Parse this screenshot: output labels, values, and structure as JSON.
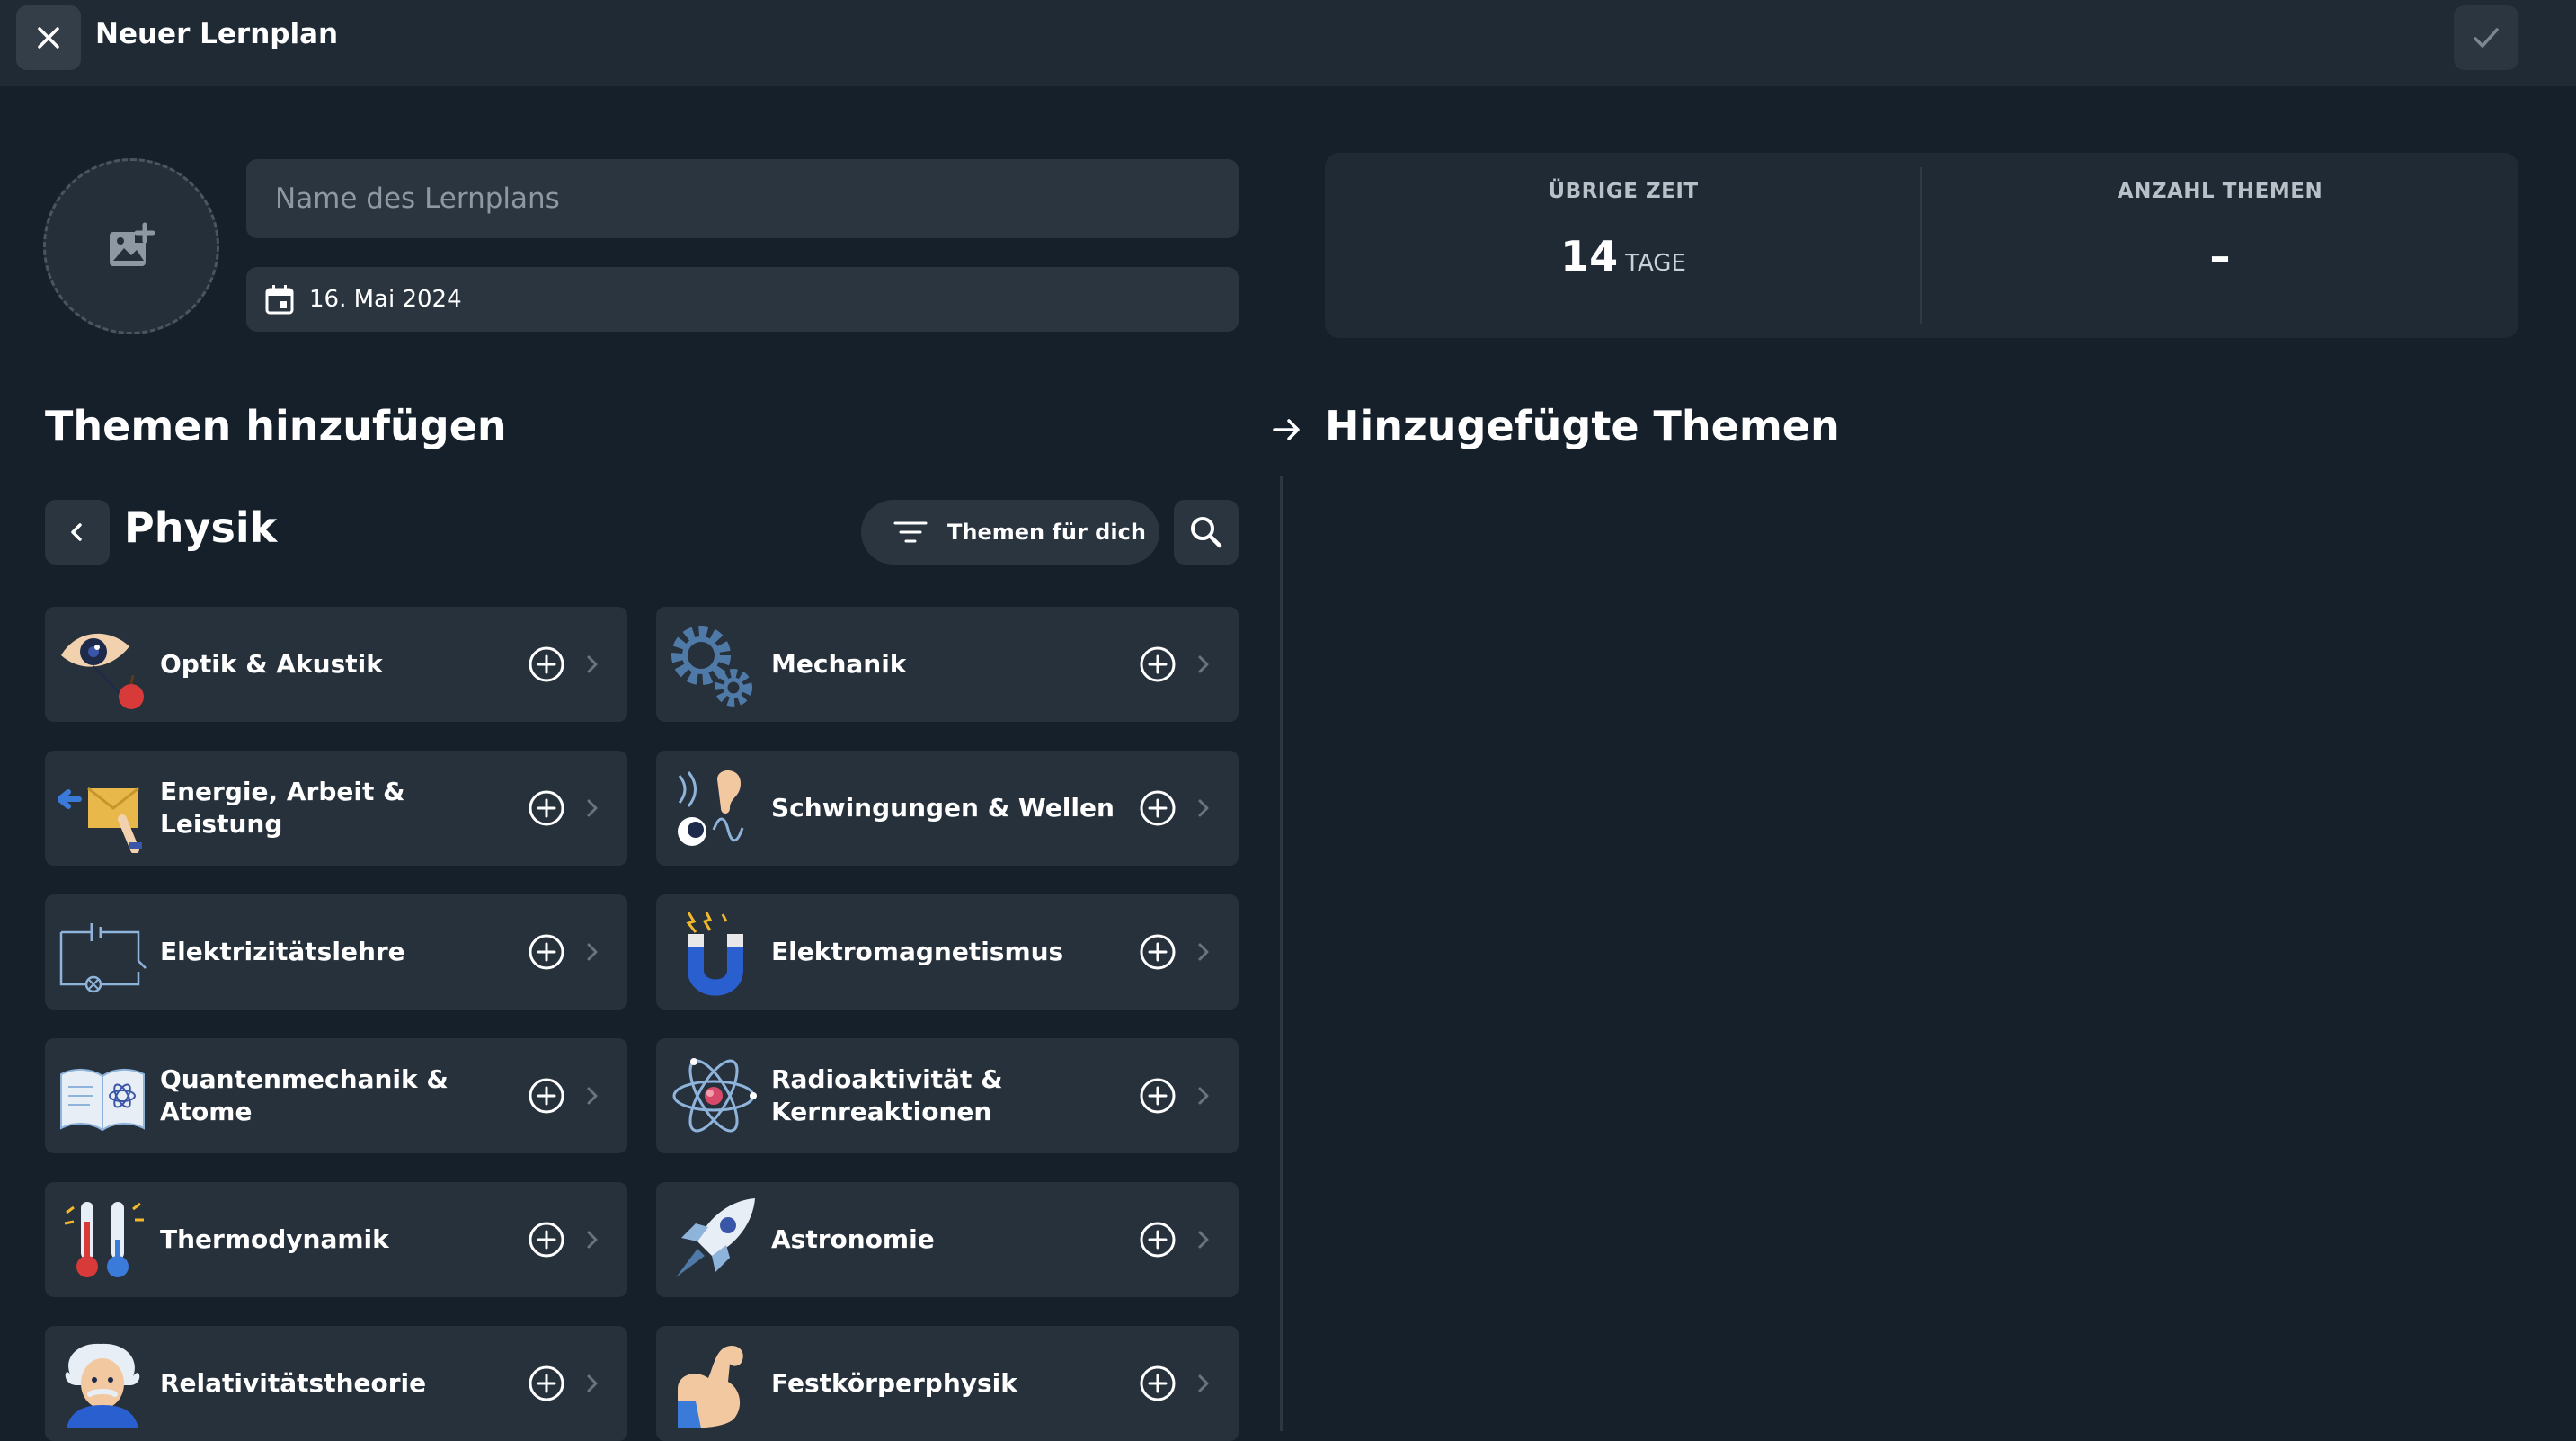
{
  "header": {
    "title": "Neuer Lernplan"
  },
  "plan": {
    "name_placeholder": "Name des Lernplans",
    "date": "16. Mai 2024"
  },
  "stats": {
    "remaining": {
      "label": "ÜBRIGE ZEIT",
      "value": "14",
      "unit": "TAGE"
    },
    "topics_count": {
      "label": "ANZAHL THEMEN",
      "value": "–"
    }
  },
  "sections": {
    "add_topics": "Themen hinzufügen",
    "added_topics": "Hinzugefügte Themen"
  },
  "subject": {
    "name": "Physik",
    "filter_label": "Themen für dich"
  },
  "topics": [
    {
      "label": "Optik & Akustik",
      "icon": "eye-apple-icon"
    },
    {
      "label": "Mechanik",
      "icon": "gears-icon"
    },
    {
      "label": "Energie, Arbeit & Leistung",
      "icon": "push-box-icon"
    },
    {
      "label": "Schwingungen & Wellen",
      "icon": "ear-wave-icon"
    },
    {
      "label": "Elektrizitätslehre",
      "icon": "circuit-icon"
    },
    {
      "label": "Elektromagnetismus",
      "icon": "magnet-icon"
    },
    {
      "label": "Quantenmechanik & Atome",
      "icon": "book-atom-icon"
    },
    {
      "label": "Radioaktivität & Kernreaktionen",
      "icon": "atom-icon"
    },
    {
      "label": "Thermodynamik",
      "icon": "thermometers-icon"
    },
    {
      "label": "Astronomie",
      "icon": "rocket-icon"
    },
    {
      "label": "Relativitätstheorie",
      "icon": "einstein-icon"
    },
    {
      "label": "Festkörperphysik",
      "icon": "flexed-arm-icon"
    }
  ],
  "colors": {
    "background": "#16202a",
    "card": "#27313b",
    "input": "#2b353f",
    "topbar": "#1f2a34"
  }
}
